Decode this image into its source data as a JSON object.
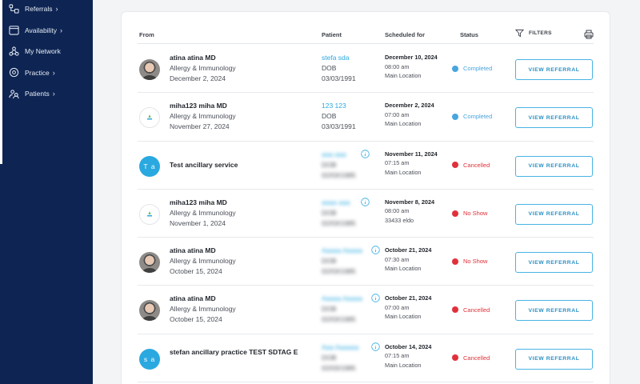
{
  "colors": {
    "sidebar_bg": "#0e2553",
    "accent": "#2aa9e0",
    "completed": "#4aa5de",
    "cancelled": "#e0313a",
    "no_show": "#e0313a"
  },
  "sidebar": {
    "items": [
      {
        "label": "Referrals",
        "icon": "referrals-icon"
      },
      {
        "label": "Availability",
        "icon": "calendar-icon"
      },
      {
        "label": "My Network",
        "icon": "network-icon"
      },
      {
        "label": "Practice",
        "icon": "practice-icon"
      },
      {
        "label": "Patients",
        "icon": "patients-icon"
      }
    ]
  },
  "table": {
    "headers": {
      "from": "From",
      "patient": "Patient",
      "scheduled": "Scheduled for",
      "status": "Status",
      "filters": "FILTERS"
    },
    "button_label": "VIEW REFERRAL",
    "rows": [
      {
        "avatar": "photo",
        "name": "atina atina MD",
        "specialty": "Allergy & Immunology",
        "date": "December 2, 2024",
        "patient": "stefa sda",
        "dob_label": "DOB",
        "dob": "03/03/1991",
        "blurred": false,
        "sched_date": "December 10, 2024",
        "sched_time": "08:00 am",
        "location": "Main Location",
        "status": "Completed",
        "status_color": "#4aa5de"
      },
      {
        "avatar": "logo",
        "name": "miha123 miha MD",
        "specialty": "Allergy & Immunology",
        "date": "November 27, 2024",
        "patient": "123 123",
        "dob_label": "DOB",
        "dob": "03/03/1991",
        "blurred": false,
        "sched_date": "December 2, 2024",
        "sched_time": "07:00 am",
        "location": "Main Location",
        "status": "Completed",
        "status_color": "#4aa5de"
      },
      {
        "avatar": "initials",
        "initials": "T a",
        "name": "Test ancillary service",
        "specialty": "",
        "date": "",
        "patient": "aaa aaa",
        "dob_label": "DOB",
        "dob": "02/03/1985",
        "blurred": true,
        "sched_date": "November 11, 2024",
        "sched_time": "07:15 am",
        "location": "Main Location",
        "status": "Cancelled",
        "status_color": "#e0313a"
      },
      {
        "avatar": "logo",
        "name": "miha123 miha MD",
        "specialty": "Allergy & Immunology",
        "date": "November 1, 2024",
        "patient": "aaaa aaa",
        "dob_label": "DOB",
        "dob": "02/03/1985",
        "blurred": true,
        "sched_date": "November 8, 2024",
        "sched_time": "08:00 am",
        "location": "33433 eldo",
        "status": "No Show",
        "status_color": "#e0313a"
      },
      {
        "avatar": "photo",
        "name": "atina atina MD",
        "specialty": "Allergy & Immunology",
        "date": "October 15, 2024",
        "patient": "Aaaaa Aaaaa",
        "dob_label": "DOB",
        "dob": "02/03/1985",
        "blurred": true,
        "sched_date": "October 21, 2024",
        "sched_time": "07:30 am",
        "location": "Main Location",
        "status": "No Show",
        "status_color": "#e0313a"
      },
      {
        "avatar": "photo",
        "name": "atina atina MD",
        "specialty": "Allergy & Immunology",
        "date": "October 15, 2024",
        "patient": "Aaaaa Aaaaa",
        "dob_label": "DOB",
        "dob": "02/03/1985",
        "blurred": true,
        "sched_date": "October 21, 2024",
        "sched_time": "07:00 am",
        "location": "Main Location",
        "status": "Cancelled",
        "status_color": "#e0313a"
      },
      {
        "avatar": "initials",
        "initials": "s a",
        "name": "stefan ancillary practice TEST SDTAG E",
        "specialty": "",
        "date": "",
        "patient": "Aaa Aaaaaa",
        "dob_label": "DOB",
        "dob": "02/03/1985",
        "blurred": true,
        "sched_date": "October 14, 2024",
        "sched_time": "07:15 am",
        "location": "Main Location",
        "status": "Cancelled",
        "status_color": "#e0313a"
      }
    ]
  }
}
